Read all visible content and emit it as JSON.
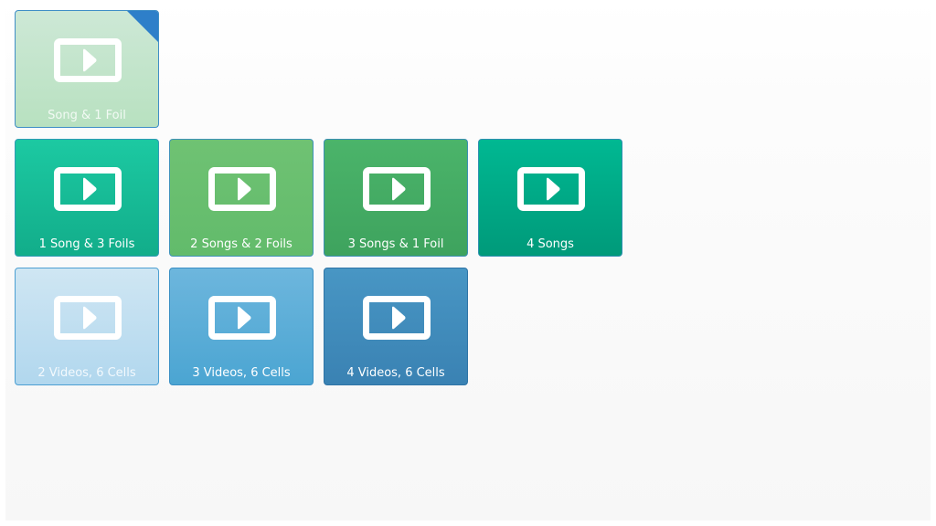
{
  "colors": {
    "flag": "#2e7fc9"
  },
  "icon": "play-video-icon",
  "rows": [
    {
      "tiles": [
        {
          "label": "Song & 1 Foil",
          "selected": true,
          "top_color": "#cde8d6",
          "bottom_color": "#b8e1c0",
          "border_color": "#3f8ec6",
          "text_color": "#f2faf4"
        }
      ]
    },
    {
      "tiles": [
        {
          "label": "1 Song & 3 Foils",
          "selected": false,
          "top_color": "#1cc9a2",
          "bottom_color": "#12ad8a",
          "border_color": "#2f9bb5",
          "text_color": "#ffffff"
        },
        {
          "label": "2 Songs & 2 Foils",
          "selected": false,
          "top_color": "#6fc273",
          "bottom_color": "#62bb6b",
          "border_color": "#3f92b9",
          "text_color": "#ffffff"
        },
        {
          "label": "3 Songs & 1 Foil",
          "selected": false,
          "top_color": "#4bb46a",
          "bottom_color": "#3ea35e",
          "border_color": "#3b8fb4",
          "text_color": "#ffffff"
        },
        {
          "label": "4 Songs",
          "selected": false,
          "top_color": "#00b892",
          "bottom_color": "#009a7a",
          "border_color": "#2f8fb0",
          "text_color": "#ffffff"
        }
      ]
    },
    {
      "tiles": [
        {
          "label": "2 Videos, 6 Cells",
          "selected": false,
          "top_color": "#cfe6f3",
          "bottom_color": "#b1d7ee",
          "border_color": "#4c9fd2",
          "text_color": "#f3f9fd"
        },
        {
          "label": "3 Videos, 6 Cells",
          "selected": false,
          "top_color": "#6db6dd",
          "bottom_color": "#4ba5d2",
          "border_color": "#3a8fc4",
          "text_color": "#ffffff"
        },
        {
          "label": "4 Videos, 6 Cells",
          "selected": false,
          "top_color": "#4896c4",
          "bottom_color": "#3a82b3",
          "border_color": "#2f74a6",
          "text_color": "#ffffff"
        }
      ]
    }
  ]
}
